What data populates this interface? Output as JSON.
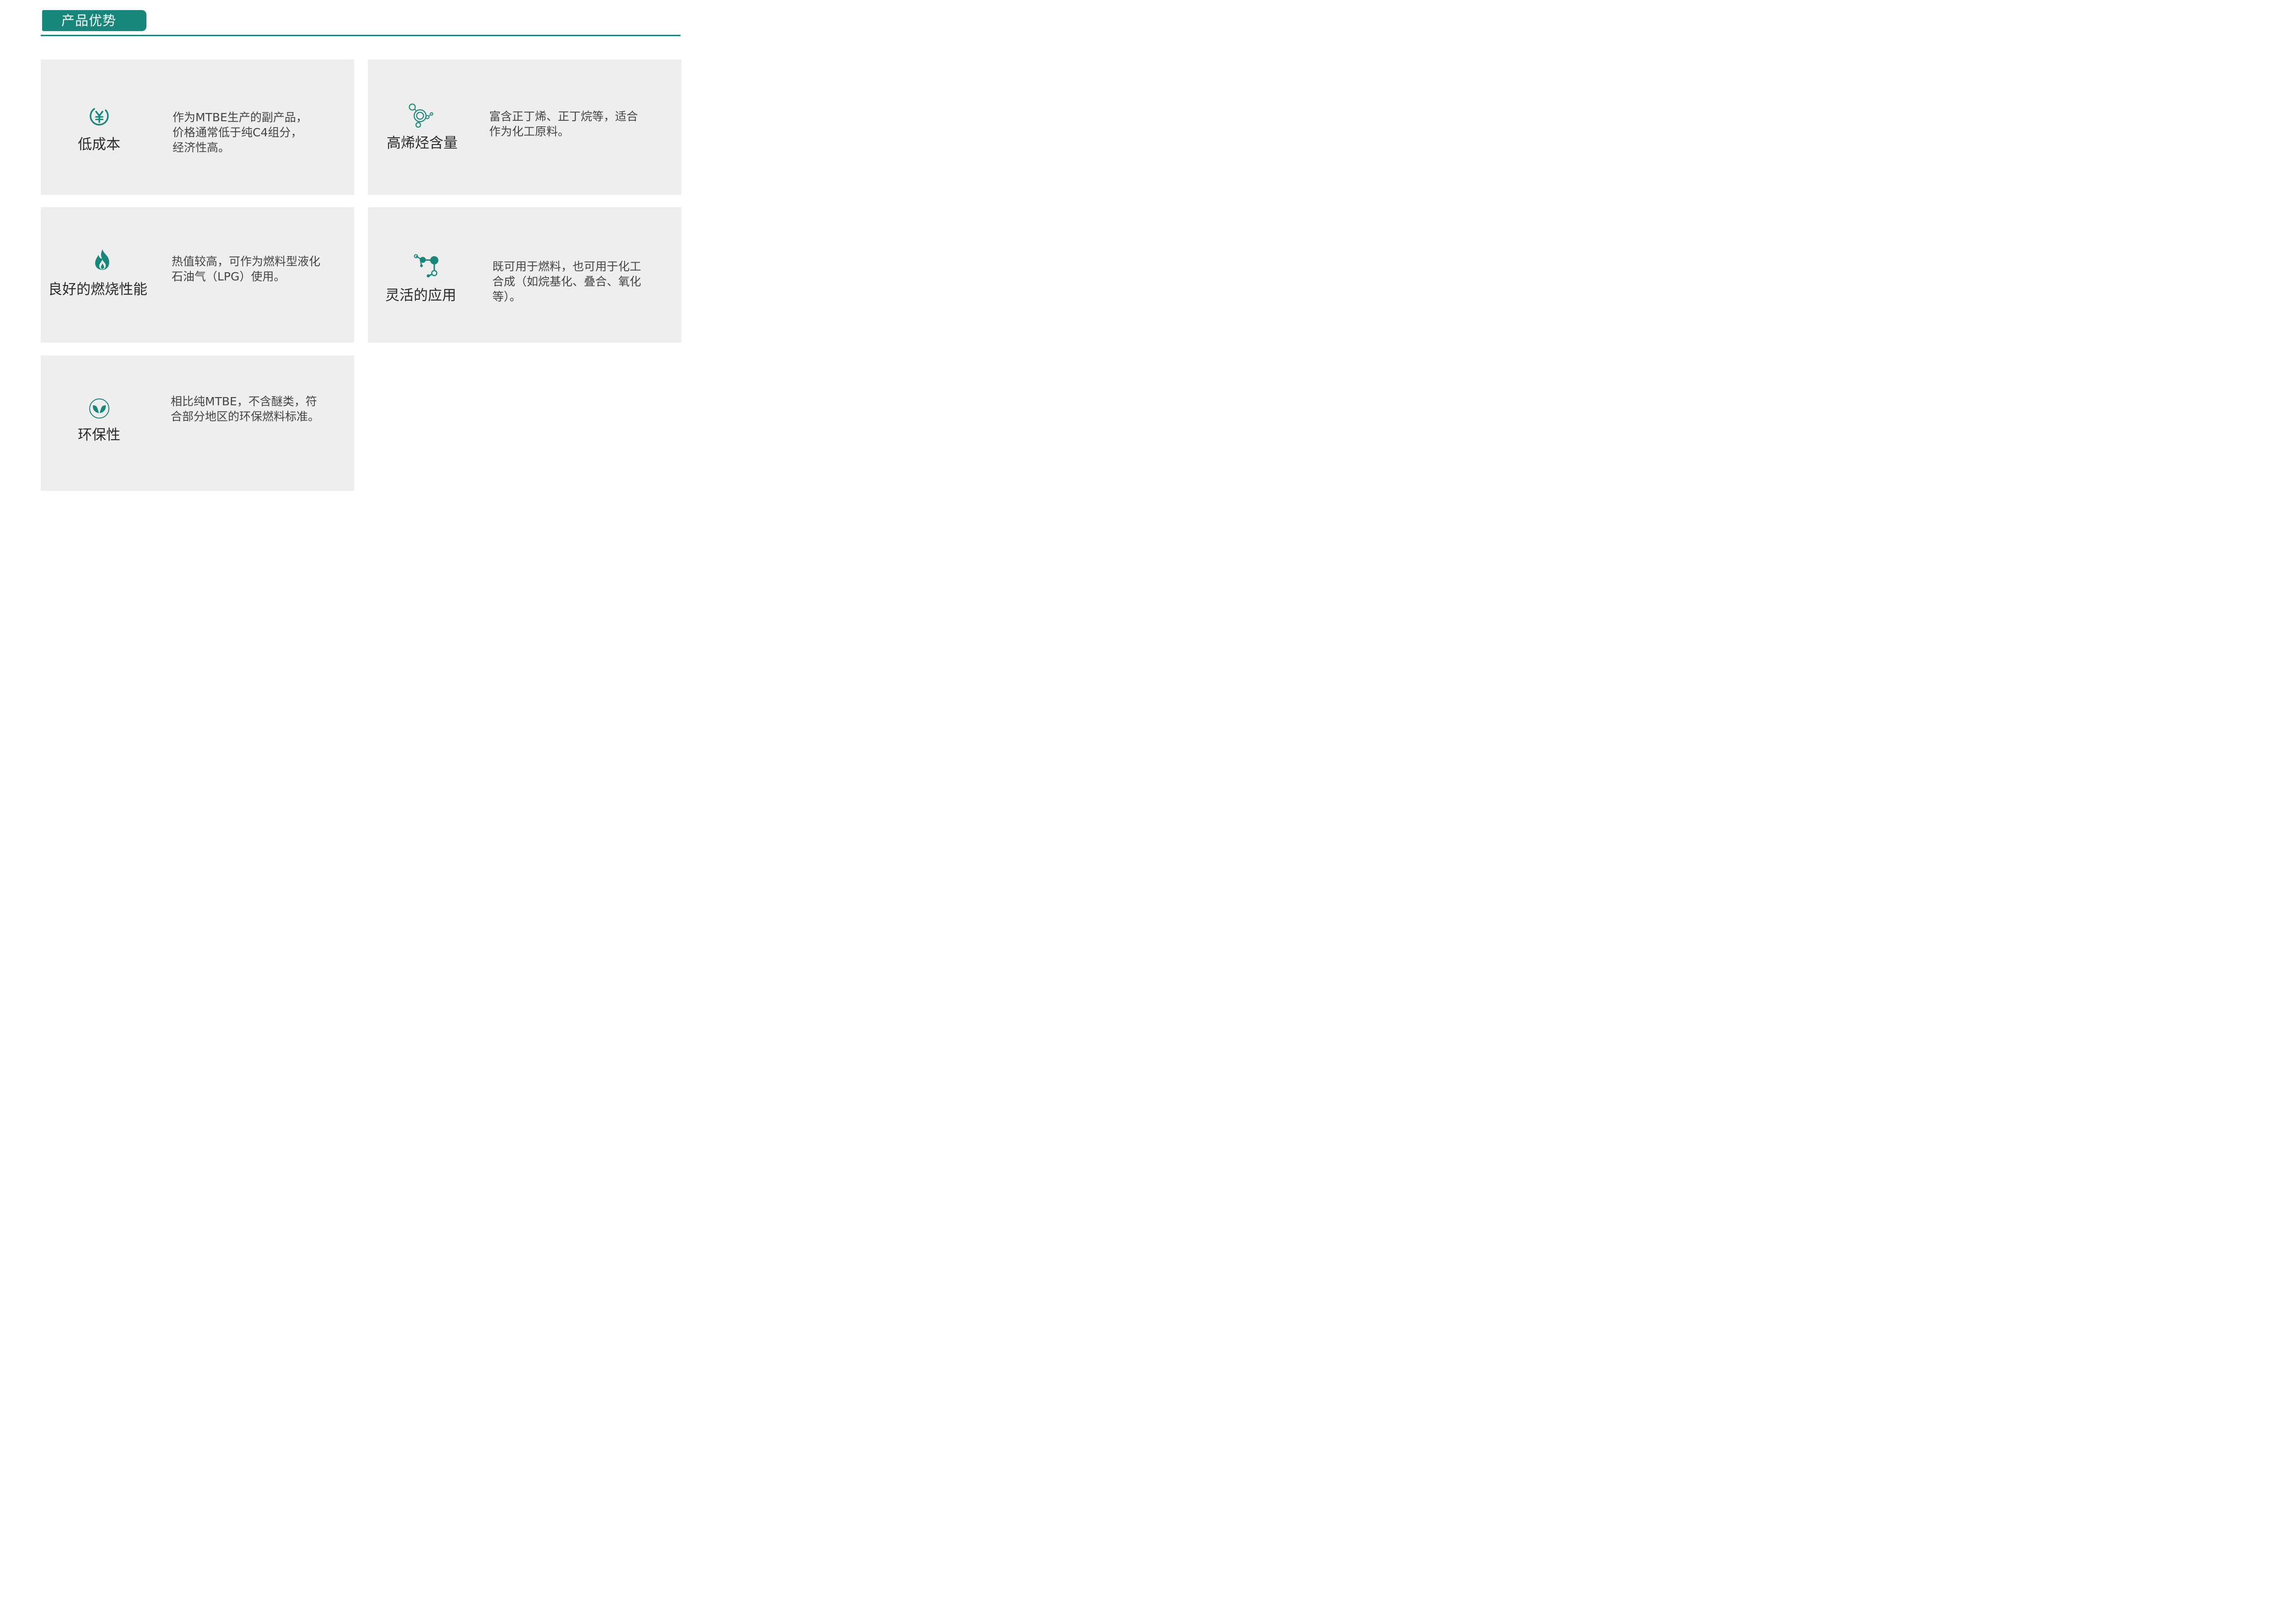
{
  "header": {
    "title": "产品优势"
  },
  "colors": {
    "accent": "#17877b",
    "card_background": "#eeeeef"
  },
  "cards": [
    {
      "icon": "yuan-icon",
      "title": "低成本",
      "lines": [
        "作为MTBE生产的副产品，",
        "价格通常低于纯C4组分，",
        "经济性高。"
      ]
    },
    {
      "icon": "molecule-rings-icon",
      "title": "高烯烃含量",
      "lines": [
        "富含正丁烯、正丁烷等，适合",
        "作为化工原料。"
      ]
    },
    {
      "icon": "flame-icon",
      "title": "良好的燃烧性能",
      "lines": [
        "热值较高，可作为燃料型液化",
        "石油气（LPG）使用。"
      ]
    },
    {
      "icon": "connected-nodes-icon",
      "title": "灵活的应用",
      "lines": [
        "既可用于燃料，也可用于化工",
        "合成（如烷基化、叠合、氧化",
        "等）。"
      ]
    },
    {
      "icon": "leaf-icon",
      "title": "环保性",
      "lines": [
        "相比纯MTBE，不含醚类，符",
        "合部分地区的环保燃料标准。"
      ]
    }
  ]
}
